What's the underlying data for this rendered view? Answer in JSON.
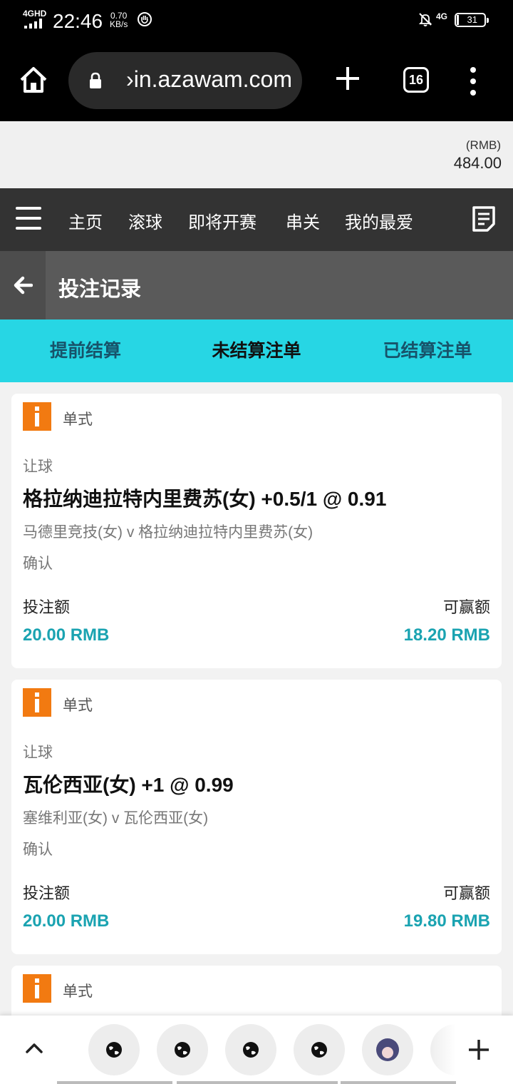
{
  "status_bar": {
    "network": "4GHD",
    "time": "22:46",
    "speed_value": "0.70",
    "speed_unit": "KB/s",
    "mobile_label": "4G",
    "battery": "31"
  },
  "browser": {
    "url": "›in.azawam.com",
    "tab_count": "16"
  },
  "balance": {
    "currency": "(RMB)",
    "amount": "484.00"
  },
  "nav": {
    "items": [
      "主页",
      "滚球",
      "即将开赛",
      "串关",
      "我的最爱"
    ]
  },
  "page": {
    "title": "投注记录"
  },
  "tabs": [
    "提前结算",
    "未结算注单",
    "已结算注单"
  ],
  "active_tab_index": 1,
  "bets": [
    {
      "type": "单式",
      "market": "让球",
      "selection": "格拉纳迪拉特内里费苏(女) +0.5/1 @ 0.91",
      "match": "马德里竞技(女) v 格拉纳迪拉特内里费苏(女)",
      "status": "确认",
      "stake_label": "投注额",
      "stake": "20.00 RMB",
      "win_label": "可赢额",
      "win": "18.20 RMB"
    },
    {
      "type": "单式",
      "market": "让球",
      "selection": "瓦伦西亚(女) +1 @ 0.99",
      "match": "塞维利亚(女) v 瓦伦西亚(女)",
      "status": "确认",
      "stake_label": "投注额",
      "stake": "20.00 RMB",
      "win_label": "可赢额",
      "win": "19.80 RMB"
    },
    {
      "type": "单式"
    }
  ],
  "colors": {
    "accent_tab_bar": "#27d6e4",
    "amount_teal": "#1aa3b1",
    "badge_orange": "#f27a11",
    "nav_dark": "#333333"
  },
  "icons": {
    "home": "home-icon",
    "lock": "lock-icon",
    "new_tab": "plus-icon",
    "menu": "more-vertical-icon",
    "hamburger": "hamburger-icon",
    "betslip": "betslip-icon",
    "back": "arrow-left-icon",
    "info": "info-icon",
    "globe": "globe-icon"
  }
}
